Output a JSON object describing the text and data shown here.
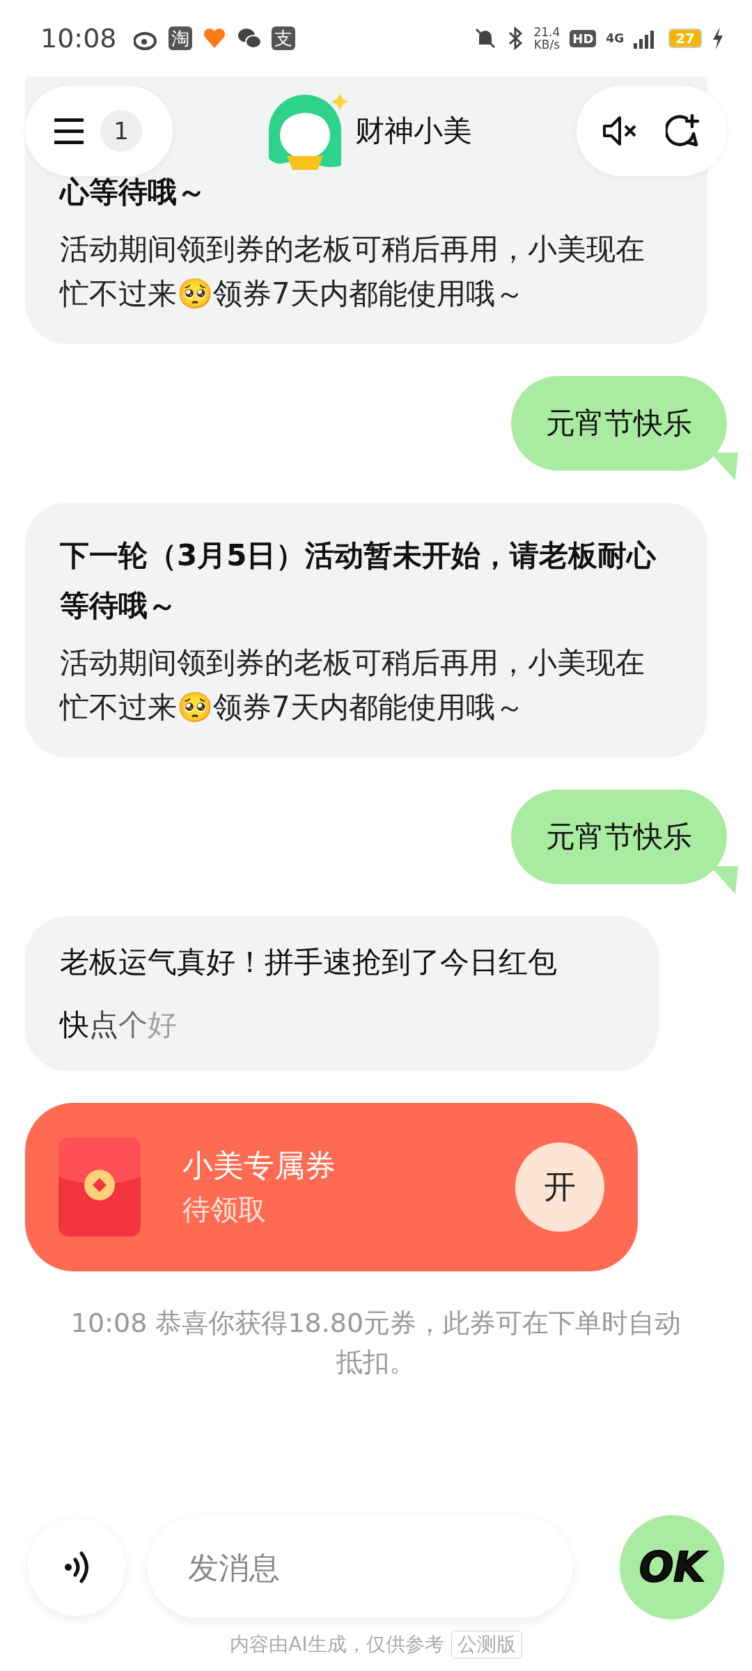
{
  "status_bar": {
    "time": "10:08",
    "app_icons": [
      {
        "kind": "weibo"
      },
      {
        "kind": "letter",
        "label": "淘"
      },
      {
        "kind": "heart"
      },
      {
        "kind": "wechat"
      },
      {
        "kind": "letter",
        "label": "支"
      }
    ],
    "speed": "21.4",
    "speed_unit": "KB/s",
    "hd": "HD",
    "network": "4G",
    "battery": "27",
    "charging": true
  },
  "header": {
    "menu_badge": "1",
    "title": "财神小美",
    "muted": true
  },
  "messages": [
    {
      "kind": "bot",
      "heading": "心等待哦～",
      "body": "活动期间领到券的老板可稍后再用，小美现在忙不过来🥺领券7天内都能使用哦～"
    },
    {
      "kind": "user",
      "text": "元宵节快乐"
    },
    {
      "kind": "bot",
      "heading": "下一轮（3月5日）活动暂未开始，请老板耐心等待哦～",
      "body": "活动期间领到券的老板可稍后再用，小美现在忙不过来🥺领券7天内都能使用哦～"
    },
    {
      "kind": "user",
      "text": "元宵节快乐"
    },
    {
      "kind": "lines",
      "streaming": true,
      "lines": [
        "老板运气真好！拼手速抢到了今日红包",
        "快点个好"
      ]
    },
    {
      "kind": "coupon",
      "title": "小美专属券",
      "status": "待领取",
      "button": "开"
    },
    {
      "kind": "system",
      "text": "10:08 恭喜你获得18.80元券，此券可在下单时自动抵扣。"
    }
  ],
  "composer": {
    "placeholder": "发消息",
    "send": "OK"
  },
  "footer": {
    "note": "内容由AI生成，仅供参考",
    "badge": "公测版"
  }
}
